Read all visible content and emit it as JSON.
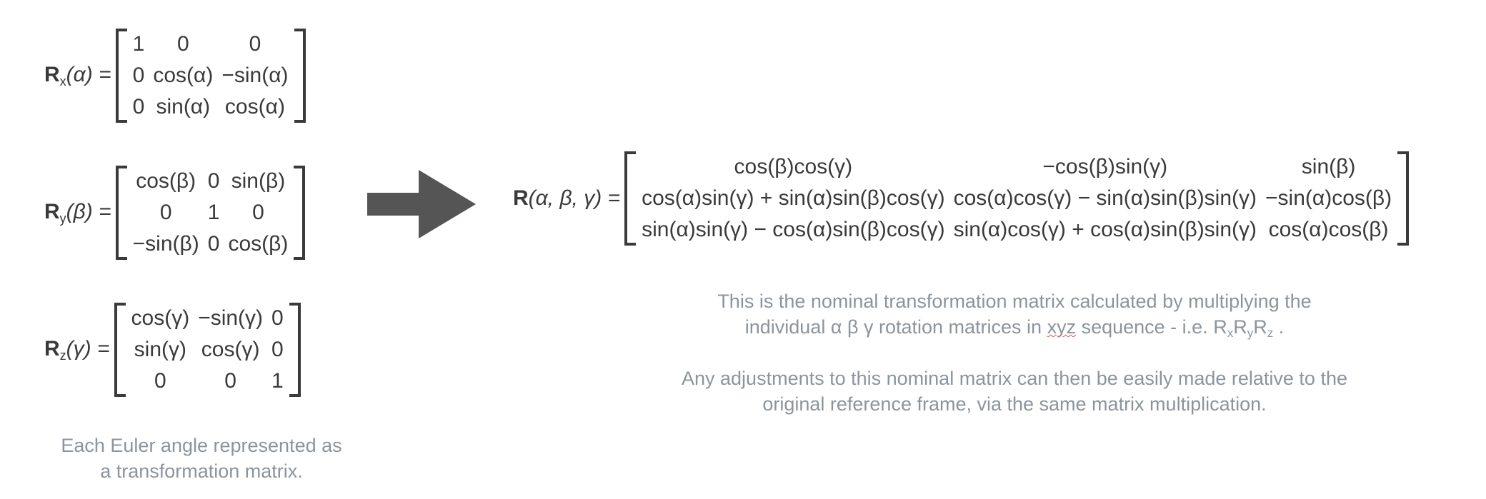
{
  "rx": {
    "symbol": "R",
    "sub": "x",
    "arg": "(α) =",
    "rows": [
      [
        "1",
        "0",
        "0"
      ],
      [
        "0",
        "cos(α)",
        "−sin(α)"
      ],
      [
        "0",
        "sin(α)",
        "cos(α)"
      ]
    ]
  },
  "ry": {
    "symbol": "R",
    "sub": "y",
    "arg": "(β) =",
    "rows": [
      [
        "cos(β)",
        "0",
        "sin(β)"
      ],
      [
        "0",
        "1",
        "0"
      ],
      [
        "−sin(β)",
        "0",
        "cos(β)"
      ]
    ]
  },
  "rz": {
    "symbol": "R",
    "sub": "z",
    "arg": "(γ) =",
    "rows": [
      [
        "cos(γ)",
        "−sin(γ)",
        "0"
      ],
      [
        "sin(γ)",
        "cos(γ)",
        "0"
      ],
      [
        "0",
        "0",
        "1"
      ]
    ]
  },
  "r": {
    "symbol": "R",
    "arg": "(α, β, γ) =",
    "rows": [
      [
        "cos(β)cos(γ)",
        "−cos(β)sin(γ)",
        "sin(β)"
      ],
      [
        "cos(α)sin(γ) + sin(α)sin(β)cos(γ)",
        "cos(α)cos(γ) − sin(α)sin(β)sin(γ)",
        "−sin(α)cos(β)"
      ],
      [
        "sin(α)sin(γ) − cos(α)sin(β)cos(γ)",
        "sin(α)cos(γ) + cos(α)sin(β)sin(γ)",
        "cos(α)cos(β)"
      ]
    ]
  },
  "captions": {
    "left_line1": "Each Euler angle represented as",
    "left_line2": "a transformation matrix.",
    "right_p1_line1": "This is the nominal transformation matrix calculated by multiplying the",
    "right_p1_line2_a": "individual α β γ rotation matrices in ",
    "right_p1_line2_b": "xyz",
    "right_p1_line2_c": " sequence - i.e. R",
    "right_p1_line2_d": "x",
    "right_p1_line2_e": "R",
    "right_p1_line2_f": "y",
    "right_p1_line2_g": "R",
    "right_p1_line2_h": "z",
    "right_p1_line2_i": " .",
    "right_p2_line1": "Any adjustments to this nominal matrix can then be easily made relative to the",
    "right_p2_line2": "original reference frame, via the same matrix multiplication."
  },
  "colors": {
    "text": "#3a3a3a",
    "caption": "#8b949d",
    "arrow": "#555555"
  }
}
